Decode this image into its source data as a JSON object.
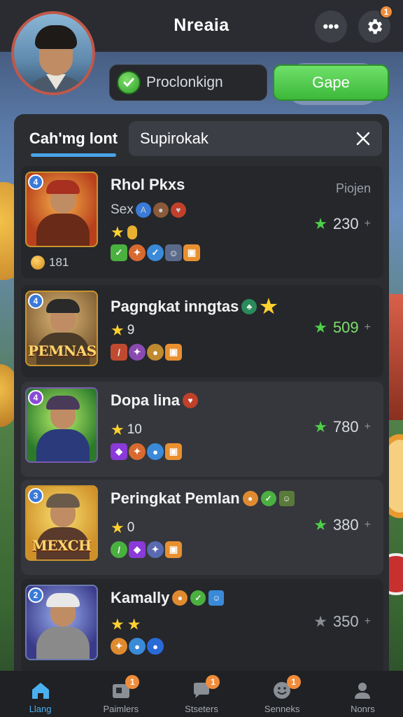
{
  "header": {
    "title": "Nreaia",
    "settings_badge": "1"
  },
  "actions": {
    "status_label": "Proclonkign",
    "play_label": "Gape"
  },
  "tabs": {
    "active": "Cah'mg lont",
    "search": "Supirokak"
  },
  "list": {
    "column_label": "Piojen",
    "rows": [
      {
        "rank": "4",
        "name": "Rhol Pkxs",
        "sub": "Sex",
        "stars": "",
        "score": "230",
        "coins": "181",
        "banner": ""
      },
      {
        "rank": "4",
        "name": "Pagngkat inngtas",
        "sub": "",
        "stars": "9",
        "score": "509",
        "coins": "",
        "banner": "PEMNAS"
      },
      {
        "rank": "4",
        "name": "Dopa lina",
        "sub": "",
        "stars": "10",
        "score": "780",
        "coins": "",
        "banner": ""
      },
      {
        "rank": "3",
        "name": "Peringkat Pemlan",
        "sub": "",
        "stars": "0",
        "score": "380",
        "coins": "",
        "banner": "MEXCH"
      },
      {
        "rank": "2",
        "name": "Kamally",
        "sub": "",
        "stars": "",
        "score": "350",
        "coins": "",
        "banner": ""
      }
    ]
  },
  "nav": {
    "items": [
      {
        "label": "Llang",
        "badge": ""
      },
      {
        "label": "Paimlers",
        "badge": "1"
      },
      {
        "label": "Stseters",
        "badge": "1"
      },
      {
        "label": "Senneks",
        "badge": "1"
      },
      {
        "label": "Nonrs",
        "badge": ""
      }
    ]
  },
  "colors": {
    "accent": "#4ab0f0",
    "play": "#4cc94a",
    "badge": "#f08c3a",
    "panel": "#2b2d31"
  }
}
